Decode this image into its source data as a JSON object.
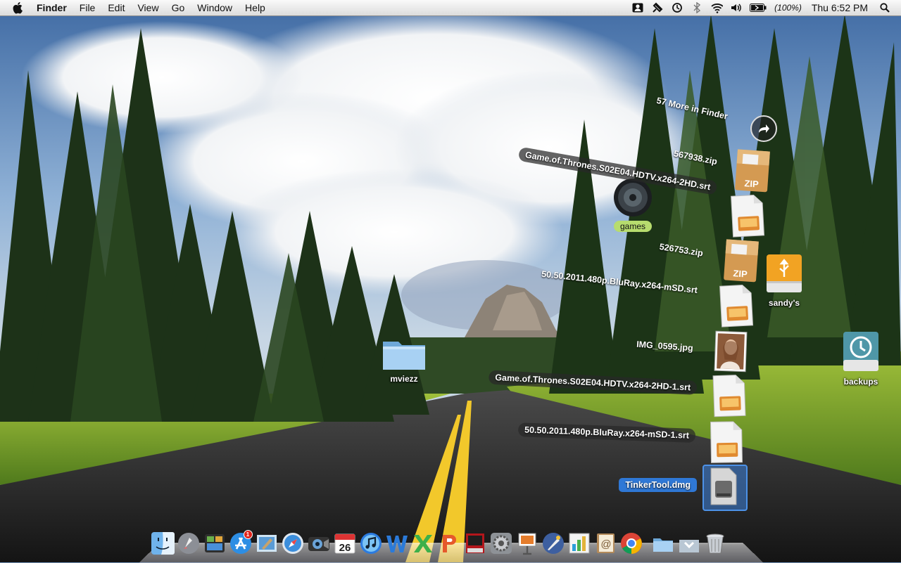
{
  "menubar": {
    "app_name": "Finder",
    "menus": [
      "File",
      "Edit",
      "View",
      "Go",
      "Window",
      "Help"
    ],
    "battery_text": "(100%)",
    "clock": "Thu 6:52 PM"
  },
  "desktop": {
    "folder_mviezz": "mviezz",
    "drive_sandys": "sandy's",
    "drive_backups": "backups",
    "games_label": "games"
  },
  "stack": {
    "more_label": "57 More in Finder",
    "items": [
      {
        "label": "567938.zip",
        "kind": "zip-icon"
      },
      {
        "label": "Game.of.Thrones.S02E04.HDTV.x264-2HD.srt",
        "kind": "document-icon"
      },
      {
        "label": "526753.zip",
        "kind": "zip-icon"
      },
      {
        "label": "50.50.2011.480p.BluRay.x264-mSD.srt",
        "kind": "document-icon"
      },
      {
        "label": "IMG_0595.jpg",
        "kind": "photo-icon"
      },
      {
        "label": "Game.of.Thrones.S02E04.HDTV.x264-2HD-1.srt",
        "kind": "document-icon"
      },
      {
        "label": "50.50.2011.480p.BluRay.x264-mSD-1.srt",
        "kind": "document-icon"
      },
      {
        "label": "TinkerTool.dmg",
        "kind": "disk-image-icon"
      }
    ],
    "zip_text": "ZIP"
  },
  "dock": {
    "apps": [
      "finder",
      "launchpad",
      "dashboard",
      "app-store",
      "mail",
      "safari",
      "facetime",
      "calendar",
      "itunes",
      "word",
      "excel",
      "powerpoint",
      "photo-booth",
      "system-preferences",
      "keynote",
      "pixelmator",
      "numbers",
      "address-book",
      "chrome",
      "documents-stack",
      "downloads-stack",
      "trash"
    ],
    "calendar_day": "26",
    "app_store_badge": "1"
  },
  "colors": {
    "selection": "#2f78d6",
    "badge": "#e2231a"
  }
}
